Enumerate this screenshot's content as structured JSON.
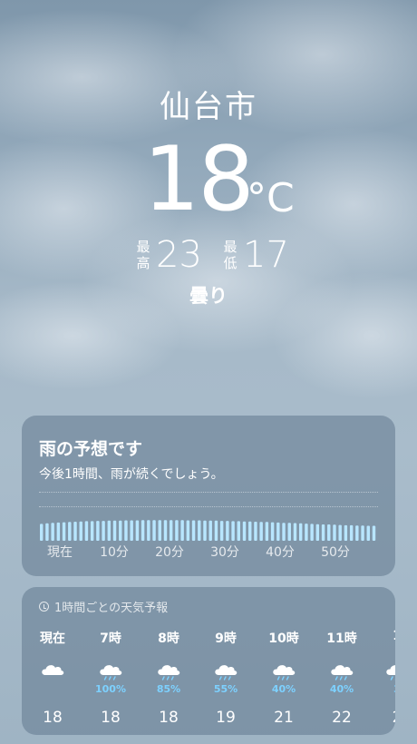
{
  "location": {
    "city": "仙台市",
    "temperature": "18",
    "unit": "°C",
    "high_label_1": "最",
    "high_label_2": "高",
    "high": "23",
    "low_label_1": "最",
    "low_label_2": "低",
    "low": "17",
    "condition": "曇り"
  },
  "rain_card": {
    "title": "雨の予想です",
    "subtitle": "今後1時間、雨が続くでしょう。",
    "intensity": [
      0.62,
      0.64,
      0.66,
      0.67,
      0.68,
      0.69,
      0.7,
      0.71,
      0.72,
      0.72,
      0.73,
      0.73,
      0.74,
      0.74,
      0.74,
      0.75,
      0.75,
      0.75,
      0.76,
      0.76,
      0.76,
      0.76,
      0.76,
      0.76,
      0.76,
      0.76,
      0.75,
      0.75,
      0.75,
      0.74,
      0.74,
      0.74,
      0.73,
      0.73,
      0.72,
      0.72,
      0.71,
      0.71,
      0.7,
      0.69,
      0.69,
      0.68,
      0.67,
      0.66,
      0.66,
      0.65,
      0.64,
      0.63,
      0.62,
      0.61,
      0.6,
      0.6,
      0.59,
      0.58,
      0.57,
      0.57,
      0.56,
      0.56,
      0.55,
      0.55
    ],
    "axis": [
      "現在",
      "10分",
      "20分",
      "30分",
      "40分",
      "50分"
    ]
  },
  "hourly": {
    "header": "1時間ごとの天気予報",
    "items": [
      {
        "time": "現在",
        "icon": "cloud-icon",
        "precip": "",
        "temp": "18"
      },
      {
        "time": "7時",
        "icon": "cloud-rain-icon",
        "precip": "100%",
        "temp": "18"
      },
      {
        "time": "8時",
        "icon": "cloud-rain-icon",
        "precip": "85%",
        "temp": "18"
      },
      {
        "time": "9時",
        "icon": "cloud-drizzle-icon",
        "precip": "55%",
        "temp": "19"
      },
      {
        "time": "10時",
        "icon": "cloud-drizzle-icon",
        "precip": "40%",
        "temp": "21"
      },
      {
        "time": "11時",
        "icon": "cloud-drizzle-icon",
        "precip": "40%",
        "temp": "22"
      },
      {
        "time": "1",
        "icon": "cloud-drizzle-icon",
        "precip": "3",
        "temp": "2"
      }
    ]
  },
  "colors": {
    "precip": "#7dd1ff",
    "bar": "#b8e6ff"
  }
}
